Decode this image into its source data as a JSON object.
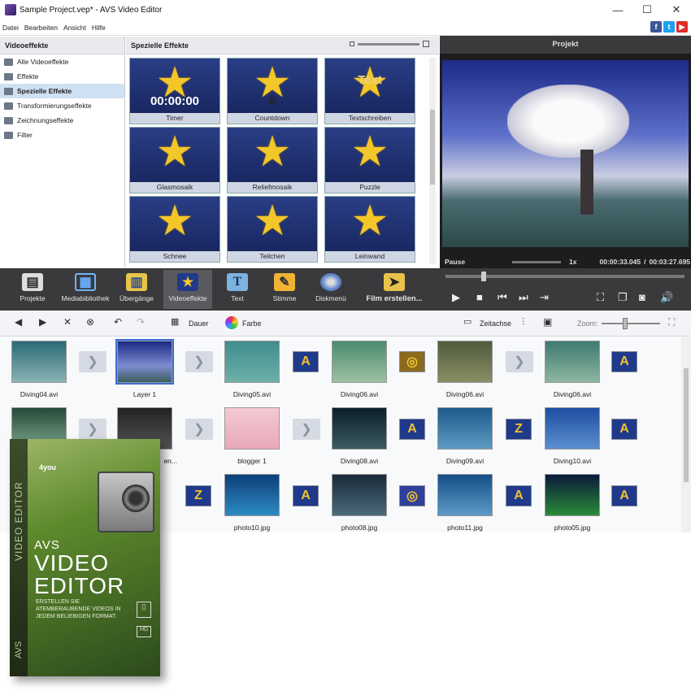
{
  "window": {
    "title": "Sample Project.vep* - AVS Video Editor",
    "min": "—",
    "max": "☐",
    "close": "✕"
  },
  "menu": [
    "Datei",
    "Bearbeiten",
    "Ansicht",
    "Hilfe"
  ],
  "social": {
    "fb": "f",
    "tw": "t",
    "yt": "▶",
    "fb_color": "#3b5998",
    "tw_color": "#1da1f2",
    "yt_color": "#e02b27"
  },
  "categories": {
    "header": "Videoeffekte",
    "items": [
      "Alle Videoeffekte",
      "Effekte",
      "Spezielle Effekte",
      "Transformierungseffekte",
      "Zeichnungseffekte",
      "Filter"
    ],
    "selected": "Spezielle Effekte"
  },
  "effects": {
    "header": "Spezielle Effekte",
    "items": [
      {
        "name": "Timer",
        "overlay": "00:00:00"
      },
      {
        "name": "Countdown",
        "overlay": "6"
      },
      {
        "name": "Textschreiben",
        "overlay": "Text"
      },
      {
        "name": "Glasmosaik",
        "overlay": ""
      },
      {
        "name": "Reliefmosaik",
        "overlay": ""
      },
      {
        "name": "Puzzle",
        "overlay": ""
      },
      {
        "name": "Schnee",
        "overlay": ""
      },
      {
        "name": "Teilchen",
        "overlay": ""
      },
      {
        "name": "Leinwand",
        "overlay": ""
      }
    ]
  },
  "preview": {
    "header": "Projekt",
    "state": "Pause",
    "speed": "1x",
    "current": "00:00:33.045",
    "separator": "/",
    "total": "00:03:27.695"
  },
  "toolbar": [
    {
      "label": "Projekte",
      "icon": "clapper-icon"
    },
    {
      "label": "Mediabibliothek",
      "icon": "film-icon"
    },
    {
      "label": "Übergänge",
      "icon": "transition-icon"
    },
    {
      "label": "Videoeffekte",
      "icon": "star-icon",
      "selected": true
    },
    {
      "label": "Text",
      "icon": "text-icon"
    },
    {
      "label": "Stimme",
      "icon": "microphone-icon"
    },
    {
      "label": "Diskmenü",
      "icon": "disc-icon"
    },
    {
      "label": "Film erstellen...",
      "icon": "clapper-arrow-icon"
    }
  ],
  "edit": {
    "dauer": "Dauer",
    "farbe": "Farbe",
    "zeitachse": "Zeitachse",
    "zoom": "Zoom:"
  },
  "clips_row1": [
    "Diving04.avi",
    "Layer 1",
    "Diving05.avi",
    "Diving06.avi",
    "Diving06.avi",
    "Diving06.avi"
  ],
  "clips_row2": [
    "",
    "blogger 1",
    "Diving08.avi",
    "Diving09.avi",
    "Diving10.avi"
  ],
  "clips_row2_partial": "en...",
  "clips_row3": [
    "photo10.jpg",
    "photo08.jpg",
    "photo11.jpg",
    "photo05.jpg"
  ],
  "box": {
    "spine": "VIDEO EDITOR",
    "spine2": "AVS",
    "brand": "AVS",
    "title1": "VIDEO",
    "title2": "EDITOR",
    "desc": "ERSTELLEN SIE ATEMBERAUBENDE VIDEOS IN JEDEM BELIEBIGEN FORMAT.",
    "logo": "4you"
  }
}
